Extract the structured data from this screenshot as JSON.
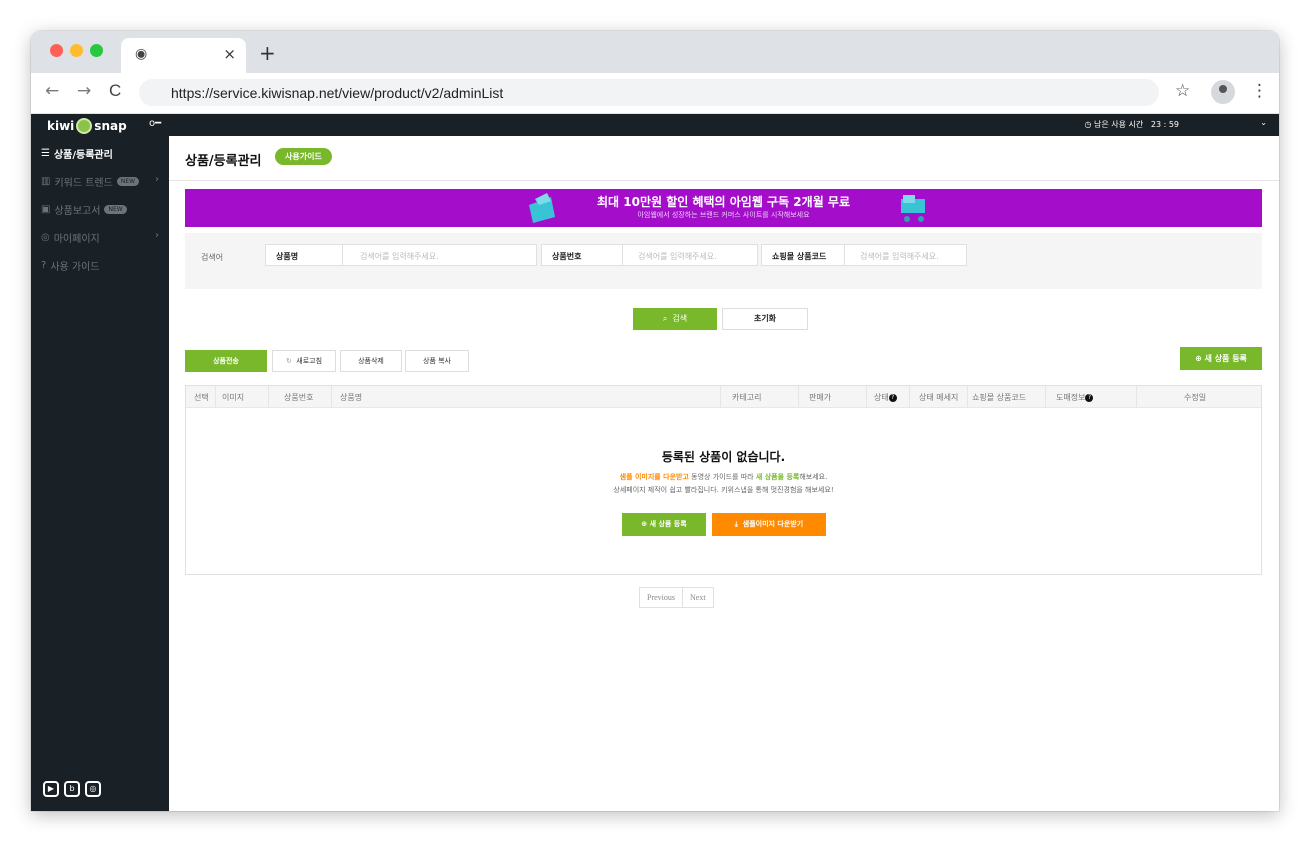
{
  "browser": {
    "url": "https://service.kiwisnap.net/view/product/v2/adminList",
    "tab_close": "×",
    "new_tab": "+",
    "back": "←",
    "forward": "→",
    "reload": "C",
    "star": "☆",
    "menu": "⋮"
  },
  "sidebar": {
    "logo_left": "kiwi",
    "logo_right": "snap",
    "items": [
      {
        "label": "상품/등록관리",
        "icon": "list-icon"
      },
      {
        "label": "키워드 트렌드",
        "badge": "NEW",
        "icon": "chart-icon"
      },
      {
        "label": "상품보고서",
        "badge": "NEW",
        "icon": "report-icon"
      },
      {
        "label": "마이페이지",
        "icon": "user-icon"
      },
      {
        "label": "사용 가이드",
        "icon": "help-icon"
      }
    ]
  },
  "topbar": {
    "timer_label": "◷ 남은 사용 시간",
    "timer_value": "23 : 59",
    "user_chevron": "⌄"
  },
  "header": {
    "title": "상품/등록관리",
    "guide_button": "사용가이드"
  },
  "banner": {
    "title": "최대 10만원 할인 혜택의 아임웹 구독 2개월 무료",
    "subtitle": "아임웹에서 성장하는 브랜드 커머스 사이트를 시작해보세요"
  },
  "search": {
    "label": "검색어",
    "fields": [
      {
        "label": "상품명",
        "placeholder": "검색어를 입력해주세요."
      },
      {
        "label": "상품번호",
        "placeholder": "검색어를 입력해주세요."
      },
      {
        "label": "쇼핑몰 상품코드",
        "placeholder": "검색어를 입력해주세요."
      }
    ],
    "search_button": "검색",
    "reset_button": "초기화"
  },
  "actions": {
    "send": "상품전송",
    "refresh": "새로고침",
    "delete": "상품삭제",
    "copy": "상품 복사",
    "new": "⊕ 새 상품 등록"
  },
  "table": {
    "columns": [
      "선택",
      "이미지",
      "상품번호",
      "상품명",
      "카테고리",
      "판매가",
      "상태",
      "상태 메세지",
      "쇼핑몰 상품코드",
      "도매정보",
      "수정일"
    ],
    "empty_title": "등록된 상품이 없습니다.",
    "empty_line1_a": "샘플 이미지를 다운받고",
    "empty_line1_b": " 동영상 가이드를 따라 ",
    "empty_line1_c": "새 상품을 등록",
    "empty_line1_d": "해보세요.",
    "empty_line2": "상세페이지 제작이 쉽고 빨라집니다. 키위스냅을 통해 멋진경험을 해보세요!",
    "new_button": "⊕ 새 상품 등록",
    "download_button": "샘플이미지 다운받기"
  },
  "pager": {
    "previous": "Previous",
    "next": "Next"
  },
  "colors": {
    "accent": "#78b82a",
    "orange": "#ff8a00",
    "banner": "#a40ecb",
    "sidebar": "#1a2126"
  }
}
